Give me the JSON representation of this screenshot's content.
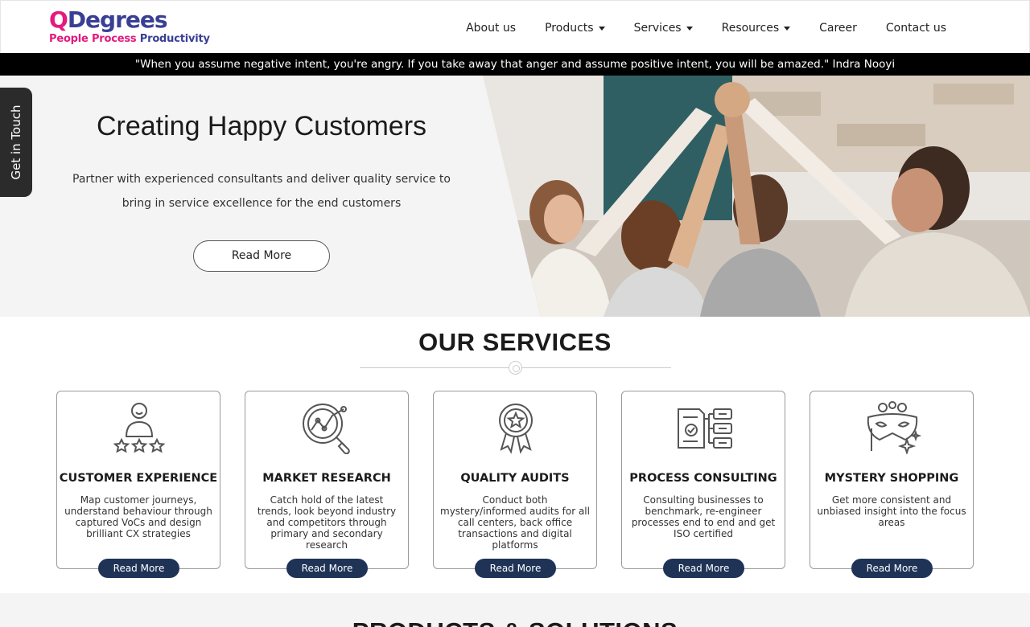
{
  "logo": {
    "q": "Q",
    "rest": "Degrees",
    "tag_people": "People Process",
    "tag_productivity": "Productivity"
  },
  "nav": {
    "about": "About us",
    "products": "Products",
    "services": "Services",
    "resources": "Resources",
    "career": "Career",
    "contact": "Contact us"
  },
  "quote": "\"When you assume negative intent, you're angry. If you take away that anger and assume positive intent, you will be amazed.\" Indra Nooyi",
  "hero": {
    "title": "Creating Happy Customers",
    "text": "Partner with experienced consultants and deliver quality service to bring in service excellence for the end customers",
    "button": "Read More"
  },
  "touch_tab": "Get in Touch",
  "services": {
    "title": "OUR SERVICES",
    "cards": [
      {
        "title": "CUSTOMER EXPERIENCE",
        "text": "Map customer journeys, understand behaviour through captured VoCs and design brilliant CX strategies",
        "button": "Read More",
        "icon": "customer-rating-icon"
      },
      {
        "title": "MARKET RESEARCH",
        "text": "Catch hold of the latest trends, look beyond industry and competitors through primary and secondary research",
        "button": "Read More",
        "icon": "magnifier-chart-icon"
      },
      {
        "title": "QUALITY AUDITS",
        "text": "Conduct both mystery/informed audits for all call centers, back office transactions and digital platforms",
        "button": "Read More",
        "icon": "award-badge-icon"
      },
      {
        "title": "PROCESS CONSULTING",
        "text": "Consulting businesses to benchmark, re-engineer processes end to end and get ISO certified",
        "button": "Read More",
        "icon": "document-server-icon"
      },
      {
        "title": "MYSTERY SHOPPING",
        "text": "Get more consistent and unbiased insight into the focus areas",
        "button": "Read More",
        "icon": "mask-icon"
      }
    ]
  },
  "bottom": {
    "title": "PRODUCTS & SOLUTIONS"
  }
}
